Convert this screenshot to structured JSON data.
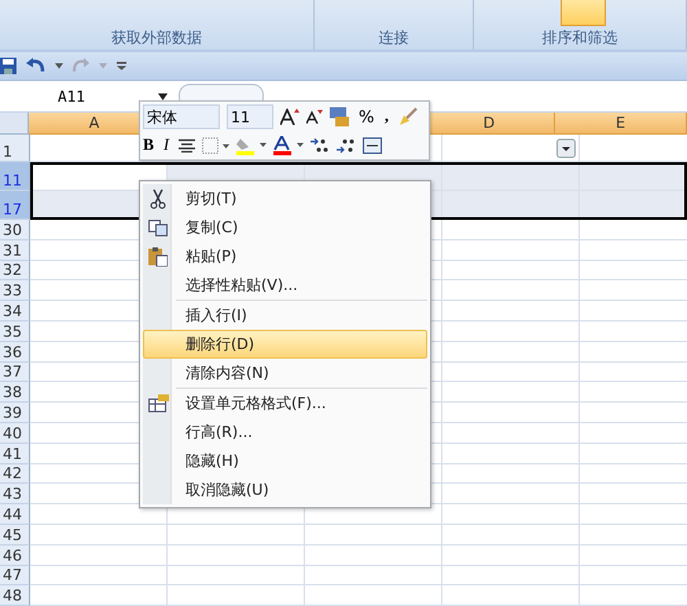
{
  "ribbon": {
    "groups": [
      {
        "label": "获取外部数据"
      },
      {
        "label": "连接"
      },
      {
        "label": "排序和筛选"
      }
    ]
  },
  "name_box": {
    "value": "A11"
  },
  "mini_toolbar": {
    "font": "宋体",
    "size": "11",
    "percent": "%",
    "comma": ",",
    "bold": "B",
    "italic": "I"
  },
  "columns": [
    {
      "label": "A",
      "selected": true
    },
    {
      "label": "D",
      "selected": true
    },
    {
      "label": "E",
      "selected": true
    }
  ],
  "rows": [
    {
      "label": "1",
      "selected": false,
      "filter": true
    },
    {
      "label": "11",
      "selected": true,
      "filter": false
    },
    {
      "label": "17",
      "selected": true,
      "filter": false
    },
    {
      "label": "30",
      "selected": false,
      "filter": false
    },
    {
      "label": "31",
      "selected": false,
      "filter": false
    },
    {
      "label": "32",
      "selected": false,
      "filter": false
    },
    {
      "label": "33",
      "selected": false,
      "filter": false
    },
    {
      "label": "34",
      "selected": false,
      "filter": false
    },
    {
      "label": "35",
      "selected": false,
      "filter": false
    },
    {
      "label": "36",
      "selected": false,
      "filter": false
    },
    {
      "label": "37",
      "selected": false,
      "filter": false
    },
    {
      "label": "38",
      "selected": false,
      "filter": false
    },
    {
      "label": "39",
      "selected": false,
      "filter": false
    },
    {
      "label": "40",
      "selected": false,
      "filter": false
    },
    {
      "label": "41",
      "selected": false,
      "filter": false
    },
    {
      "label": "42",
      "selected": false,
      "filter": false
    },
    {
      "label": "43",
      "selected": false,
      "filter": false
    },
    {
      "label": "44",
      "selected": false,
      "filter": false
    },
    {
      "label": "45",
      "selected": false,
      "filter": false
    },
    {
      "label": "46",
      "selected": false,
      "filter": false
    },
    {
      "label": "47",
      "selected": false,
      "filter": false
    },
    {
      "label": "48",
      "selected": false,
      "filter": false
    }
  ],
  "context_menu": [
    [
      {
        "label": "剪切(T)",
        "selected": false
      },
      {
        "label": "复制(C)",
        "selected": false
      },
      {
        "label": "粘贴(P)",
        "selected": false
      },
      {
        "label": "选择性粘贴(V)...",
        "selected": false
      }
    ],
    [
      {
        "label": "插入行(I)",
        "selected": false
      },
      {
        "label": "删除行(D)",
        "selected": true
      },
      {
        "label": "清除内容(N)",
        "selected": false
      }
    ],
    [
      {
        "label": "设置单元格格式(F)...",
        "selected": false
      },
      {
        "label": "行高(R)...",
        "selected": false
      },
      {
        "label": "隐藏(H)",
        "selected": false
      },
      {
        "label": "取消隐藏(U)",
        "selected": false
      }
    ]
  ]
}
